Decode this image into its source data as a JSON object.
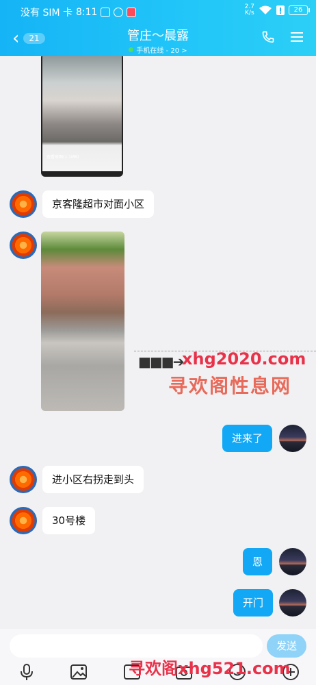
{
  "status_bar": {
    "carrier": "没有 SIM 卡",
    "time": "8:11",
    "net_speed_value": "2.7",
    "net_speed_unit": "K/s",
    "battery": "26"
  },
  "header": {
    "unread_count": "21",
    "title": "管庄～晨露",
    "subtitle": "手机在线 - 20 >"
  },
  "messages": [
    {
      "type": "image",
      "direction": "in",
      "image_caption": "查看原图(1.1MB)"
    },
    {
      "type": "text",
      "direction": "in",
      "text": "京客隆超市对面小区"
    },
    {
      "type": "image",
      "direction": "in"
    },
    {
      "type": "text",
      "direction": "out",
      "text": "进来了"
    },
    {
      "type": "text",
      "direction": "in",
      "text": "进小区右拐走到头"
    },
    {
      "type": "text",
      "direction": "in",
      "text": "30号楼"
    },
    {
      "type": "text",
      "direction": "out",
      "text": "恩"
    },
    {
      "type": "text",
      "direction": "out",
      "text": "开门"
    }
  ],
  "watermarks": {
    "site_name": "寻欢阁性息网",
    "site_url": "xhg2020.com",
    "bottom": "寻欢阁xhg521.com"
  },
  "input": {
    "placeholder": "",
    "send_label": "发送"
  },
  "icons": [
    "back-chevron-icon",
    "phone-icon",
    "menu-icon",
    "mic-icon",
    "image-icon",
    "photo-icon",
    "camera-icon",
    "emoji-icon",
    "plus-icon"
  ],
  "colors": {
    "header": "#1ab8f6",
    "outgoing_bubble": "#12a8f5",
    "send_button": "#8fd3f8",
    "watermark_red": "#e8324a"
  }
}
